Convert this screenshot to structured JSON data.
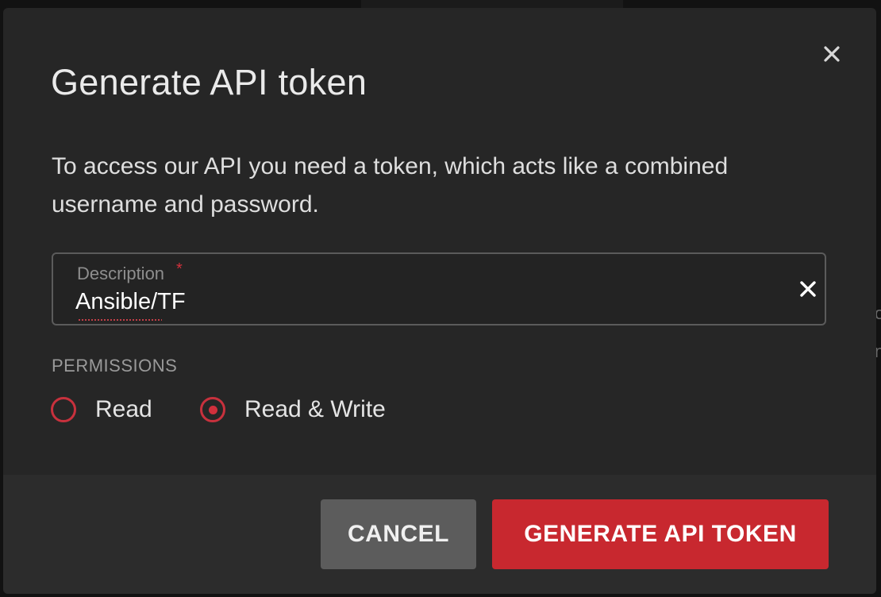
{
  "dialog": {
    "title": "Generate API token",
    "intro": "To access our API you need a token, which acts like a combined username and password.",
    "close_icon": "close-icon"
  },
  "description_field": {
    "label": "Description",
    "required_marker": "*",
    "value": "Ansible/TF",
    "clear_icon": "clear-icon"
  },
  "permissions": {
    "label": "PERMISSIONS",
    "options": [
      {
        "label": "Read",
        "selected": false
      },
      {
        "label": "Read & Write",
        "selected": true
      }
    ]
  },
  "footer": {
    "cancel_label": "CANCEL",
    "generate_label": "GENERATE API TOKEN"
  },
  "colors": {
    "accent": "#c8282f",
    "dialog_bg": "#262626",
    "cancel_bg": "#5c5c5c"
  }
}
